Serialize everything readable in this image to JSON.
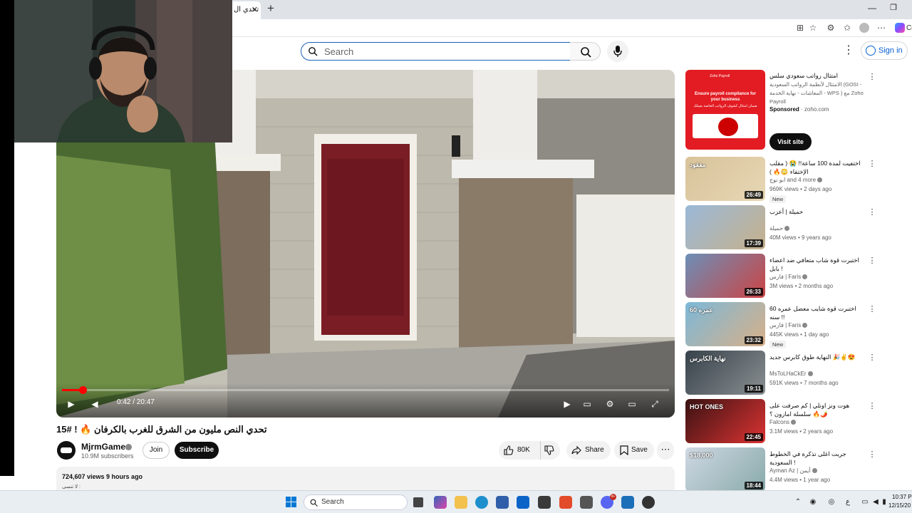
{
  "browser": {
    "tab_title": "تحدي ال",
    "tab_close": "✕",
    "new_tab": "+",
    "copilot_label": "Co"
  },
  "youtube": {
    "search_placeholder": "Search",
    "sign_in": "Sign in"
  },
  "player": {
    "current_time": "0:42",
    "duration": "20:47",
    "time_text": "0:42 / 20:47",
    "progress_fraction": 0.034
  },
  "video": {
    "title": "تحدي النص مليون من الشرق للغرب بالكرفان 🔥 ! #15",
    "channel": "MjrmGames",
    "subscribers": "10.9M subscribers",
    "join": "Join",
    "subscribe": "Subscribe",
    "likes": "80K",
    "share": "Share",
    "save": "Save",
    "views": "724,607 views",
    "posted": "9 hours ago",
    "stats_text": "724,607 views  9 hours ago",
    "description_first_line": "لا تنسى :"
  },
  "ad": {
    "thumb_brand": "Zoho Payroll",
    "thumb_headline": "Ensure payroll compliance for your business",
    "thumb_arabic": "ضمان امتثال كشوف الرواتب الخاصة بعملك",
    "title": "امتثال رواتب سعودي سلس",
    "description": "الامتثال لأنظمة الرواتب السعودية (GOSI - المعاشات - نهاية الخدمة - WPS ) مع Zoho Payroll",
    "sponsored": "Sponsored",
    "domain": "zoho.com",
    "cta": "Visit site"
  },
  "recommendations": [
    {
      "title": "اختفيت لمدة 100 ساعة!! 😭 ( مقلب الإختفاء 😳🔥 )",
      "channel": "ابو نوح and 4 more",
      "meta": "969K views • 2 days ago",
      "duration": "26:49",
      "badge": "New",
      "thumb_text": "مفقود"
    },
    {
      "title": "حميلة | أعزب",
      "channel": "حميلة",
      "meta": "40M views • 9 years ago",
      "duration": "17:39",
      "badge": "",
      "thumb_text": ""
    },
    {
      "title": "اختبرت قوة شاب متعافي ضد اعضاء بابل !",
      "channel": "فارس | Faris",
      "meta": "3M views • 2 months ago",
      "duration": "26:33",
      "badge": "",
      "thumb_text": ""
    },
    {
      "title": "اختبرت قوة شايب معضل عمره 60 سنه !!",
      "channel": "فارس | Faris",
      "meta": "445K views • 1 day ago",
      "duration": "23:32",
      "badge": "New",
      "thumb_text": "عمره 60"
    },
    {
      "title": "النهاية طوق كابرس جديد 🎉✌️😍",
      "channel": "MsToLHaCkEr",
      "meta": "591K views • 7 months ago",
      "duration": "19:11",
      "badge": "",
      "thumb_text": "نهاية الكابرس"
    },
    {
      "title": "هوت ونز اونلي | كم صرفت على سلسلة امازون ؟ 🔥🌶️",
      "channel": "Falcons",
      "meta": "3.1M views • 2 years ago",
      "duration": "22:45",
      "badge": "",
      "thumb_text": "HOT ONES"
    },
    {
      "title": "جربت اغلى تذكرة في الخطوط السعودية !",
      "channel": "Ayman Az | أيمن",
      "meta": "4.4M views • 1 year ago",
      "duration": "18:44",
      "badge": "",
      "thumb_text": "$18,000"
    }
  ],
  "taskbar": {
    "search": "Search",
    "notification_badge": "9+",
    "lang": "ع",
    "time": "10:37 P",
    "date": "12/15/20"
  },
  "colors": {
    "yt_red": "#ff0000",
    "link_blue": "#065fd4",
    "ad_red": "#e31c23"
  }
}
